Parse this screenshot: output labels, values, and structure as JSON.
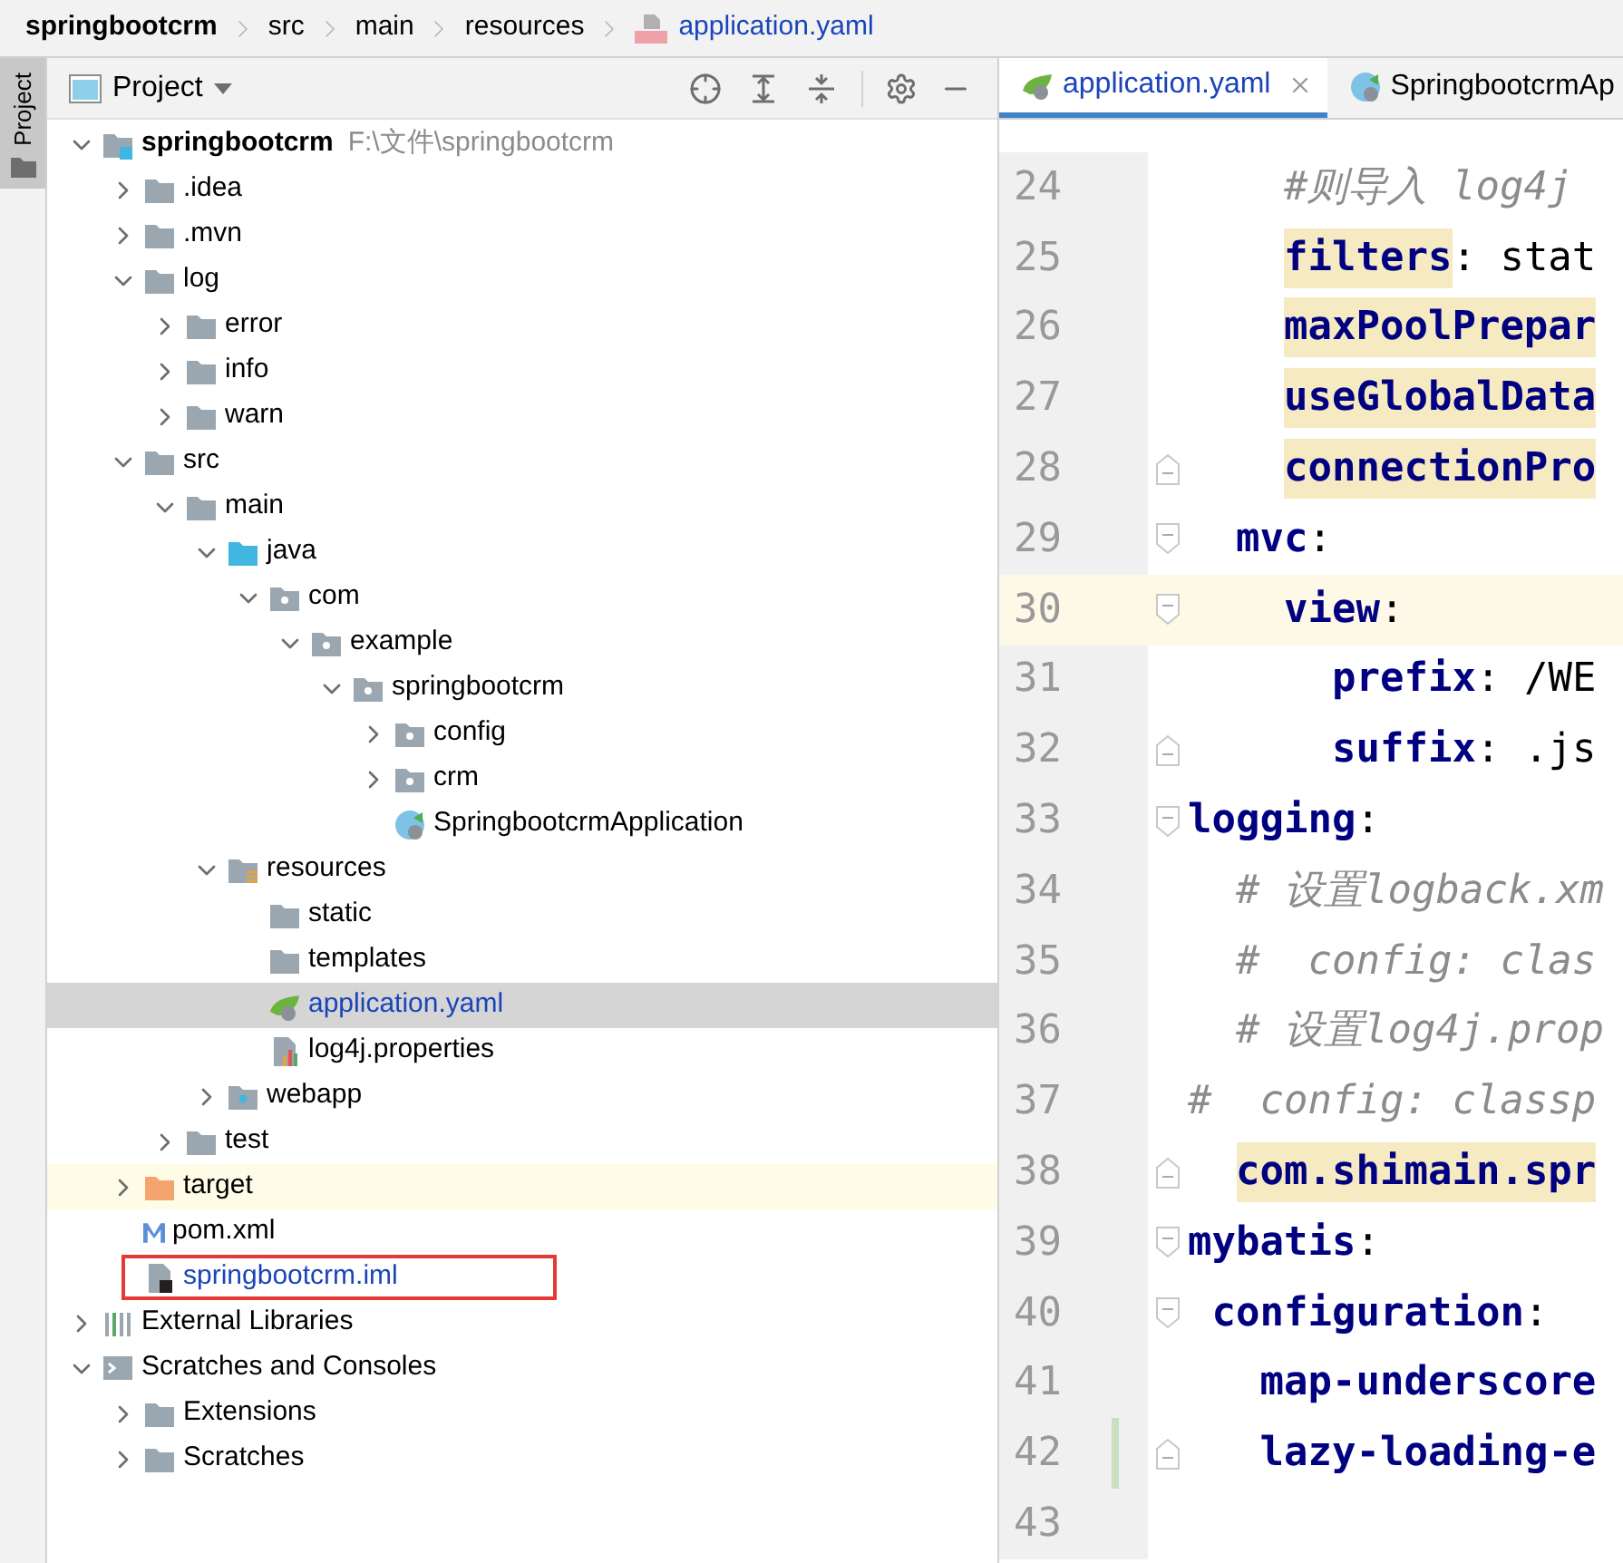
{
  "breadcrumb": [
    {
      "label": "springbootcrm",
      "kind": "project"
    },
    {
      "label": "src",
      "kind": "folder"
    },
    {
      "label": "main",
      "kind": "folder"
    },
    {
      "label": "resources",
      "kind": "folder"
    },
    {
      "label": "application.yaml",
      "kind": "yaml"
    }
  ],
  "tool_strip": [
    {
      "label": "Project",
      "selected": true
    }
  ],
  "project_panel": {
    "title": "Project",
    "tree": [
      {
        "label": "springbootcrm",
        "path": "F:\\文件\\springbootcrm",
        "kind": "module",
        "expanded": true,
        "children": [
          {
            "label": ".idea",
            "kind": "folder",
            "expanded": false
          },
          {
            "label": ".mvn",
            "kind": "folder",
            "expanded": false
          },
          {
            "label": "log",
            "kind": "folder",
            "expanded": true,
            "children": [
              {
                "label": "error",
                "kind": "folder",
                "expanded": false
              },
              {
                "label": "info",
                "kind": "folder",
                "expanded": false
              },
              {
                "label": "warn",
                "kind": "folder",
                "expanded": false
              }
            ]
          },
          {
            "label": "src",
            "kind": "folder",
            "expanded": true,
            "children": [
              {
                "label": "main",
                "kind": "folder",
                "expanded": true,
                "children": [
                  {
                    "label": "java",
                    "kind": "source",
                    "expanded": true,
                    "children": [
                      {
                        "label": "com",
                        "kind": "package",
                        "expanded": true,
                        "children": [
                          {
                            "label": "example",
                            "kind": "package",
                            "expanded": true,
                            "children": [
                              {
                                "label": "springbootcrm",
                                "kind": "package",
                                "expanded": true,
                                "children": [
                                  {
                                    "label": "config",
                                    "kind": "package",
                                    "expanded": false
                                  },
                                  {
                                    "label": "crm",
                                    "kind": "package",
                                    "expanded": false
                                  },
                                  {
                                    "label": "SpringbootcrmApplication",
                                    "kind": "spring-class"
                                  }
                                ]
                              }
                            ]
                          }
                        ]
                      }
                    ]
                  },
                  {
                    "label": "resources",
                    "kind": "resources",
                    "expanded": true,
                    "children": [
                      {
                        "label": "static",
                        "kind": "folder"
                      },
                      {
                        "label": "templates",
                        "kind": "folder"
                      },
                      {
                        "label": "application.yaml",
                        "kind": "spring-yaml",
                        "selected": true,
                        "changed": true
                      },
                      {
                        "label": "log4j.properties",
                        "kind": "properties"
                      }
                    ]
                  },
                  {
                    "label": "webapp",
                    "kind": "web",
                    "expanded": false
                  }
                ]
              },
              {
                "label": "test",
                "kind": "folder",
                "expanded": false
              }
            ]
          },
          {
            "label": "target",
            "kind": "excluded",
            "expanded": false,
            "tinted": true
          },
          {
            "label": "pom.xml",
            "kind": "maven"
          },
          {
            "label": "springbootcrm.iml",
            "kind": "iml",
            "changed": true,
            "annotated": true
          }
        ]
      },
      {
        "label": "External Libraries",
        "kind": "libraries",
        "expanded": false
      },
      {
        "label": "Scratches and Consoles",
        "kind": "scratches",
        "expanded": true,
        "children": [
          {
            "label": "Extensions",
            "kind": "folder",
            "expanded": false
          },
          {
            "label": "Scratches",
            "kind": "folder",
            "expanded": false
          }
        ]
      }
    ]
  },
  "editor": {
    "tabs": [
      {
        "label": "application.yaml",
        "kind": "spring-yaml",
        "selected": true
      },
      {
        "label": "SpringbootcrmAp",
        "kind": "spring-class",
        "selected": false
      }
    ],
    "lines": [
      {
        "number": "24",
        "parts": [
          {
            "kind": "comment",
            "text": "    #则导入 log4j"
          }
        ]
      },
      {
        "number": "25",
        "parts": [
          {
            "kind": "key",
            "text": "    filters",
            "highlighted": true
          },
          {
            "kind": "plain",
            "text": ": stat"
          }
        ]
      },
      {
        "number": "26",
        "parts": [
          {
            "kind": "key",
            "text": "    maxPoolPrepar",
            "highlighted": true
          }
        ]
      },
      {
        "number": "27",
        "parts": [
          {
            "kind": "key",
            "text": "    useGlobalData",
            "highlighted": true
          }
        ]
      },
      {
        "number": "28",
        "fold": {
          "kind": "end"
        },
        "parts": [
          {
            "kind": "key",
            "text": "    connectionPro",
            "highlighted": true
          }
        ]
      },
      {
        "number": "29",
        "fold": {
          "kind": "start"
        },
        "parts": [
          {
            "kind": "key",
            "text": "  mvc"
          },
          {
            "kind": "plain",
            "text": ":"
          }
        ]
      },
      {
        "number": "30",
        "fold": {
          "kind": "start"
        },
        "current": true,
        "parts": [
          {
            "kind": "key",
            "text": "    view"
          },
          {
            "kind": "plain",
            "text": ":"
          }
        ]
      },
      {
        "number": "31",
        "parts": [
          {
            "kind": "key",
            "text": "      prefix"
          },
          {
            "kind": "plain",
            "text": ": /WE"
          }
        ]
      },
      {
        "number": "32",
        "fold": {
          "kind": "end"
        },
        "parts": [
          {
            "kind": "key",
            "text": "      suffix"
          },
          {
            "kind": "plain",
            "text": ": .js"
          }
        ]
      },
      {
        "number": "33",
        "fold": {
          "kind": "start"
        },
        "parts": [
          {
            "kind": "key",
            "text": "logging"
          },
          {
            "kind": "plain",
            "text": ":"
          }
        ]
      },
      {
        "number": "34",
        "parts": [
          {
            "kind": "comment",
            "text": "  # 设置logback.xm"
          }
        ]
      },
      {
        "number": "35",
        "parts": [
          {
            "kind": "comment",
            "text": "  #  config: clas"
          }
        ]
      },
      {
        "number": "36",
        "parts": [
          {
            "kind": "comment",
            "text": "  # 设置log4j.prop"
          }
        ]
      },
      {
        "number": "37",
        "parts": [
          {
            "kind": "comment",
            "text": "#  config: classp"
          }
        ]
      },
      {
        "number": "38",
        "fold": {
          "kind": "end"
        },
        "parts": [
          {
            "kind": "key",
            "text": "  com.shimain.spr",
            "highlighted": true
          }
        ]
      },
      {
        "number": "39",
        "fold": {
          "kind": "start"
        },
        "parts": [
          {
            "kind": "key",
            "text": "mybatis"
          },
          {
            "kind": "plain",
            "text": ":"
          }
        ]
      },
      {
        "number": "40",
        "fold": {
          "kind": "start"
        },
        "parts": [
          {
            "kind": "key",
            "text": " configuration"
          },
          {
            "kind": "plain",
            "text": ":"
          }
        ]
      },
      {
        "number": "41",
        "parts": [
          {
            "kind": "key",
            "text": "   map-underscore"
          }
        ]
      },
      {
        "number": "42",
        "fold": {
          "kind": "end"
        },
        "changed": true,
        "parts": [
          {
            "kind": "key",
            "text": "   lazy-loading-e"
          }
        ]
      },
      {
        "number": "43"
      }
    ]
  }
}
